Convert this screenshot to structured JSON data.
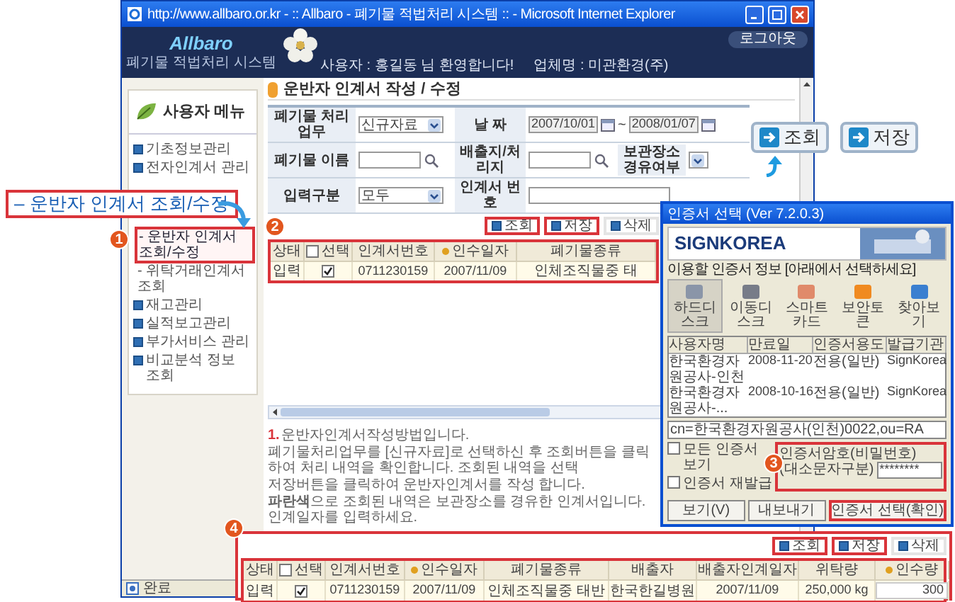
{
  "window": {
    "title": "http://www.allbaro.or.kr - :: Allbaro - 폐기물 적법처리 시스템 :: - Microsoft Internet Explorer"
  },
  "header": {
    "logo": "Allbaro",
    "logo_subtitle": "폐기물 적법처리 시스템",
    "user": "사용자 : 홍길동 님 환영합니다!",
    "company": "업체명 : 미관환경(주)",
    "logout": "로그아웃"
  },
  "sidebar": {
    "title": "사용자 메뉴",
    "items": [
      {
        "label": "기초정보관리",
        "kind": "menu",
        "selected": false
      },
      {
        "label": "전자인계서 관리",
        "kind": "menu",
        "selected": false
      },
      {
        "label": "- 운반자 인계서 조회/수정",
        "kind": "sub",
        "selected": true
      },
      {
        "label": "- 위탁거래인계서 조회",
        "kind": "sub",
        "selected": false
      },
      {
        "label": "재고관리",
        "kind": "menu",
        "selected": false
      },
      {
        "label": "실적보고관리",
        "kind": "menu",
        "selected": false
      },
      {
        "label": "부가서비스 관리",
        "kind": "menu",
        "selected": false
      },
      {
        "label": "비교분석 정보 조회",
        "kind": "menu",
        "selected": false
      }
    ]
  },
  "page_title": "운반자 인계서 작성 / 수정",
  "form": {
    "rows": [
      [
        {
          "label": "폐기물 처리업무",
          "kind": "select",
          "value": "신규자료"
        },
        {
          "label": "날 짜",
          "kind": "date_range",
          "from": "2007/10/01",
          "separator": "~",
          "to": "2008/01/07"
        }
      ],
      [
        {
          "label": "폐기물 이름",
          "kind": "search"
        },
        {
          "label": "배출지/처리지",
          "kind": "search"
        },
        {
          "label": "보관장소 경유여부",
          "kind": "select"
        }
      ],
      [
        {
          "label": "입력구분",
          "kind": "select",
          "value": "모두"
        },
        {
          "label": "인계서 번호",
          "kind": "text"
        }
      ]
    ]
  },
  "actions": [
    {
      "label": "조회",
      "highlighted": true
    },
    {
      "label": "저장",
      "highlighted": true
    },
    {
      "label": "삭제",
      "highlighted": false
    }
  ],
  "table": {
    "columns": [
      {
        "label": "상태",
        "kind": "text"
      },
      {
        "label": "선택",
        "kind": "check",
        "checked": false
      },
      {
        "label": "인계서번호",
        "kind": "text"
      },
      {
        "label": "인수일자",
        "kind": "required"
      },
      {
        "label": "폐기물종류",
        "kind": "text"
      }
    ],
    "rows": [
      {
        "checked": true,
        "cells": [
          "입력",
          "",
          "0711230159",
          "2007/11/09",
          "인체조직물중 태"
        ]
      }
    ]
  },
  "notes": {
    "number": "1.",
    "heading": "운반자인계서작성방법입니다.",
    "lines": [
      "폐기물처리업무를 [신규자료]로 선택하신 후 조회버튼을 클릭하여 처리 내역을 확인합니다. 조회된 내역을 선택",
      "저장버튼을 클릭하여 운반자인계서를 작성 합니다.",
      "**파란색**으로 조회된 내역은 보관장소를 경유한 인계서입니다. 인계일자를 입력하세요."
    ]
  },
  "status_bar": "완료",
  "callout": "– 운반자 인계서 조회/수정",
  "shortcut_buttons": [
    "조회",
    "저장"
  ],
  "markers": [
    "1",
    "2",
    "3",
    "4"
  ],
  "dialog": {
    "title": "인증서 선택 (Ver 7.2.0.3)",
    "brand": "SIGNKOREA",
    "caption": "이용할 인증서 정보 [아래에서 선택하세요]",
    "media": [
      {
        "label": "하드디스크",
        "selected": true
      },
      {
        "label": "이동디스크",
        "selected": false
      },
      {
        "label": "스마트카드",
        "selected": false
      },
      {
        "label": "보안토큰",
        "selected": false
      },
      {
        "label": "찾아보기",
        "selected": false
      }
    ],
    "list": {
      "columns": [
        "사용자명",
        "만료일",
        "인증서용도",
        "발급기관"
      ],
      "rows": [
        [
          "한국환경자원공사-인천",
          "2008-11-20",
          "전용(일반)",
          "SignKorea"
        ],
        [
          "한국환경자원공사-...",
          "2008-10-16",
          "전용(일반)",
          "SignKorea"
        ]
      ]
    },
    "subject": "cn=한국환경자원공사(인천)0022,ou=RA",
    "options": [
      {
        "label": "모든 인증서 보기",
        "checked": false
      },
      {
        "label": "인증서 재발급",
        "checked": false
      }
    ],
    "password": {
      "label": "인증서암호(비밀번호)",
      "hint": "(대소문자구분)",
      "value": "********"
    },
    "buttons": [
      {
        "label": "보기(V)",
        "highlighted": false
      },
      {
        "label": "내보내기",
        "highlighted": false
      },
      {
        "label": "인증서 선택(확인)",
        "highlighted": true
      }
    ]
  },
  "bottom_panel": {
    "actions": [
      {
        "label": "조회",
        "highlighted": true
      },
      {
        "label": "저장",
        "highlighted": true
      },
      {
        "label": "삭제",
        "highlighted": false
      }
    ],
    "table": {
      "columns": [
        {
          "label": "상태",
          "kind": "text"
        },
        {
          "label": "선택",
          "kind": "check",
          "checked": false
        },
        {
          "label": "인계서번호",
          "kind": "text"
        },
        {
          "label": "인수일자",
          "kind": "required"
        },
        {
          "label": "폐기물종류",
          "kind": "text"
        },
        {
          "label": "배출자",
          "kind": "text"
        },
        {
          "label": "배출자인계일자",
          "kind": "text"
        },
        {
          "label": "위탁량",
          "kind": "text"
        },
        {
          "label": "인수량",
          "kind": "required_input"
        }
      ],
      "rows": [
        {
          "checked": true,
          "cells": [
            "입력",
            "",
            "0711230159",
            "2007/11/09",
            "인체조직물중 태반",
            "한국한길병원",
            "2007/11/09",
            "250,000 kg",
            "300"
          ]
        }
      ]
    }
  }
}
